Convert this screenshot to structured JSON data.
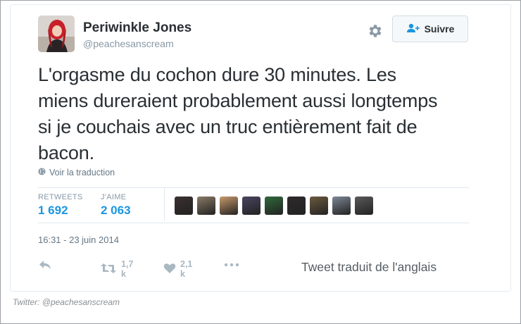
{
  "user": {
    "display_name": "Periwinkle Jones",
    "handle": "@peachesanscream"
  },
  "follow_button": {
    "label": "Suivre"
  },
  "tweet": {
    "lines": [
      "L'orgasme du cochon dure 30 minutes. Les",
      "miens dureraient probablement aussi longtemps",
      "si je couchais avec un truc entièrement fait de",
      "bacon."
    ],
    "translate_label": "Voir la traduction",
    "timestamp": "16:31 - 23 juin 2014"
  },
  "stats": {
    "retweets": {
      "label": "RETWEETS",
      "value": "1 692"
    },
    "likes": {
      "label": "J'AIME",
      "value": "2 063"
    }
  },
  "likers": [
    {
      "icon": "avatar",
      "color": "#3b3030"
    },
    {
      "icon": "avatar",
      "color": "#8a7a66"
    },
    {
      "icon": "avatar",
      "color": "#c79a6a"
    },
    {
      "icon": "avatar",
      "color": "#4a4560"
    },
    {
      "icon": "avatar",
      "color": "#2f6a3a"
    },
    {
      "icon": "avatar",
      "color": "#2e2a2a"
    },
    {
      "icon": "avatar",
      "color": "#6b5a3e"
    },
    {
      "icon": "avatar",
      "color": "#7d8896"
    },
    {
      "icon": "avatar",
      "color": "#5a5a5a"
    }
  ],
  "actions": {
    "reply": {
      "icon": "reply-icon"
    },
    "retweet": {
      "icon": "retweet-icon",
      "count": "1,7 k"
    },
    "like": {
      "icon": "heart-icon",
      "count": "2,1 k"
    },
    "more": {
      "icon": "more-icon"
    }
  },
  "translated_note": "Tweet traduit de l'anglais",
  "caption": "Twitter: @peachesanscream",
  "colors": {
    "accent": "#1b95e0",
    "muted": "#aab8c2",
    "text": "#292f33"
  }
}
